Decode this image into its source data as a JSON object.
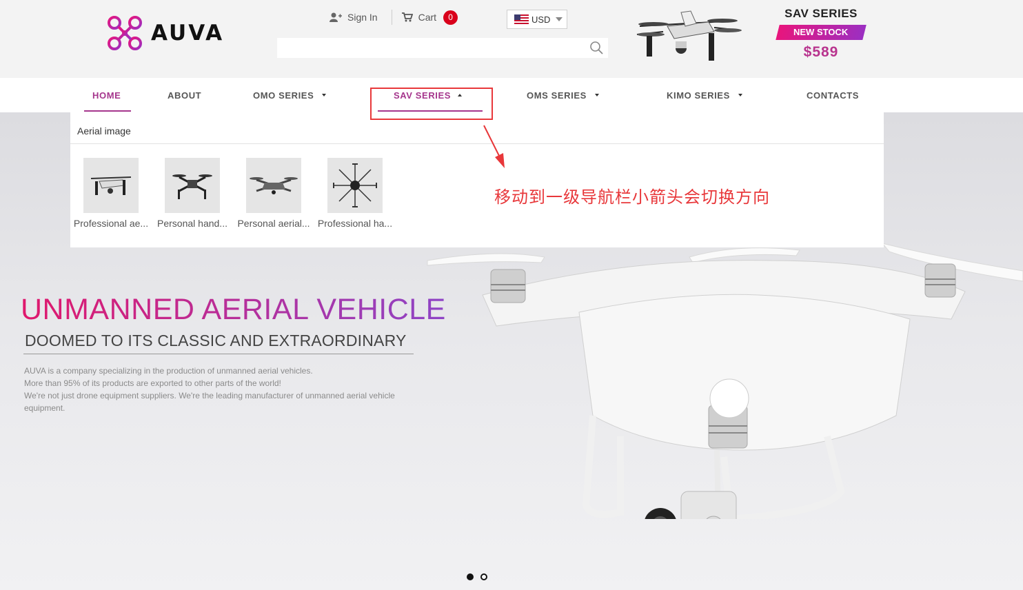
{
  "brand": {
    "name": "AUVA",
    "accent": "#a5358c"
  },
  "top_links": {
    "sign_in": "Sign In",
    "cart": "Cart",
    "cart_count": "0"
  },
  "currency": {
    "value": "USD"
  },
  "search": {
    "placeholder": ""
  },
  "promo": {
    "title": "SAV SERIES",
    "badge": "NEW STOCK",
    "price": "$589"
  },
  "nav": {
    "items": [
      {
        "label": "HOME",
        "active": true
      },
      {
        "label": "ABOUT"
      },
      {
        "label": "OMO SERIES",
        "has_dropdown": true
      },
      {
        "label": "SAV SERIES",
        "has_dropdown": true,
        "open": true
      },
      {
        "label": "OMS SERIES",
        "has_dropdown": true
      },
      {
        "label": "KIMO SERIES",
        "has_dropdown": true
      },
      {
        "label": "CONTACTS"
      }
    ]
  },
  "dropdown": {
    "heading": "Aerial image",
    "items": [
      {
        "label": "Professional ae..."
      },
      {
        "label": "Personal hand..."
      },
      {
        "label": "Personal aerial..."
      },
      {
        "label": "Professional ha..."
      }
    ]
  },
  "annotation": {
    "text": "移动到一级导航栏小箭头会切换方向",
    "color": "#e8373a"
  },
  "hero": {
    "title": "UNMANNED AERIAL VEHICLE",
    "subtitle": "DOOMED TO ITS CLASSIC AND EXTRAORDINARY",
    "desc1": "AUVA is a company specializing in the production of unmanned aerial vehicles.",
    "desc2": "More than 95% of its products are exported to other parts of the world!",
    "desc3": "We're not just drone equipment suppliers. We're the leading manufacturer of unmanned aerial vehicle equipment.",
    "slides": 2,
    "current_slide": 1
  }
}
